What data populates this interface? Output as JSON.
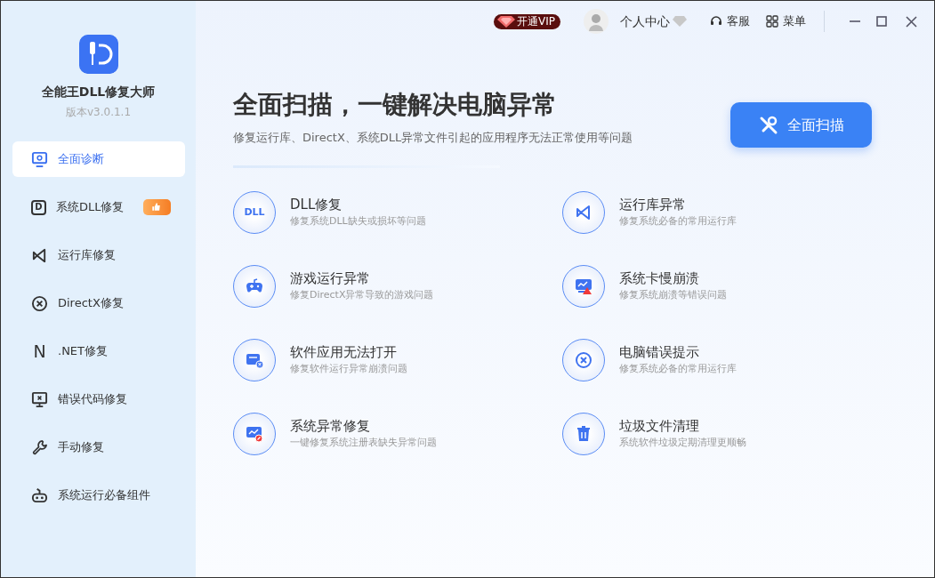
{
  "app": {
    "name": "全能王DLL修复大师",
    "version": "版本v3.0.1.1"
  },
  "sidebar": {
    "items": [
      {
        "label": "全面诊断",
        "kind": "monitor-search",
        "selected": true,
        "recommended": false
      },
      {
        "label": "系统DLL修复",
        "kind": "letter",
        "glyph": "D",
        "selected": false,
        "recommended": true
      },
      {
        "label": "运行库修复",
        "kind": "vs",
        "selected": false,
        "recommended": false
      },
      {
        "label": "DirectX修复",
        "kind": "x-circle",
        "selected": false,
        "recommended": false
      },
      {
        "label": ".NET修复",
        "kind": "plain-letter",
        "glyph": "N",
        "selected": false,
        "recommended": false
      },
      {
        "label": "错误代码修复",
        "kind": "monitor-x",
        "selected": false,
        "recommended": false
      },
      {
        "label": "手动修复",
        "kind": "wrench",
        "selected": false,
        "recommended": false
      },
      {
        "label": "系统运行必备组件",
        "kind": "robot",
        "selected": false,
        "recommended": false
      }
    ]
  },
  "topbar": {
    "vip": "开通VIP",
    "user": "个人中心",
    "service": "客服",
    "menu": "菜单"
  },
  "hero": {
    "title": "全面扫描，一键解决电脑异常",
    "subtitle": "修复运行库、DirectX、系统DLL异常文件引起的应用程序无法正常使用等问题",
    "button": "全面扫描"
  },
  "features": [
    {
      "title": "DLL修复",
      "desc": "修复系统DLL缺失或损坏等问题",
      "kind": "dll",
      "glyph": "DLL"
    },
    {
      "title": "运行库异常",
      "desc": "修复系统必备的常用运行库",
      "kind": "vs"
    },
    {
      "title": "游戏运行异常",
      "desc": "修复DirectX异常导致的游戏问题",
      "kind": "gamepad"
    },
    {
      "title": "系统卡慢崩溃",
      "desc": "修复系统崩溃等错误问题",
      "kind": "monitor-warn"
    },
    {
      "title": "软件应用无法打开",
      "desc": "修复软件运行异常崩溃问题",
      "kind": "window-x"
    },
    {
      "title": "电脑错误提示",
      "desc": "修复系统必备的常用运行库",
      "kind": "x-circle"
    },
    {
      "title": "系统异常修复",
      "desc": "一键修复系统注册表缺失异常问题",
      "kind": "monitor-repair"
    },
    {
      "title": "垃圾文件清理",
      "desc": "系统软件垃圾定期清理更顺畅",
      "kind": "trash"
    }
  ]
}
